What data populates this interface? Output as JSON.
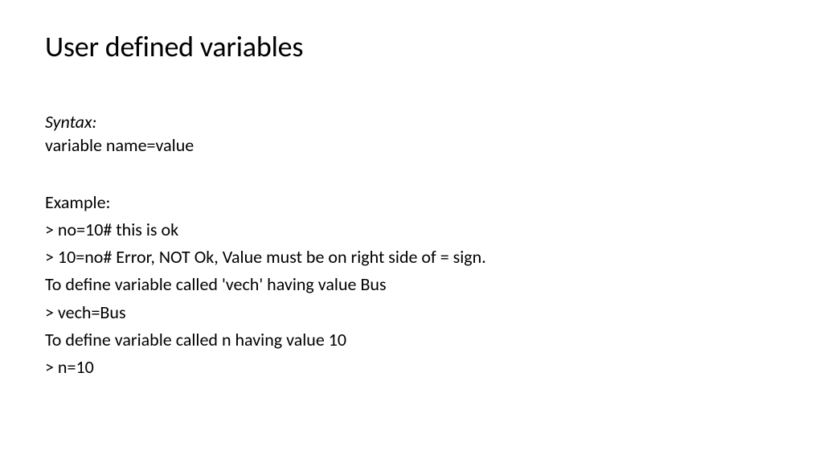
{
  "title": "User defined variables",
  "syntax": {
    "label": "Syntax:",
    "definition": "variable name=value"
  },
  "example": {
    "label": "Example:",
    "lines": [
      "> no=10# this is ok",
      "> 10=no# Error, NOT Ok, Value must be on right side of = sign.",
      "To define variable called 'vech' having value Bus",
      "> vech=Bus",
      "To define variable called n having value 10",
      "> n=10"
    ]
  }
}
